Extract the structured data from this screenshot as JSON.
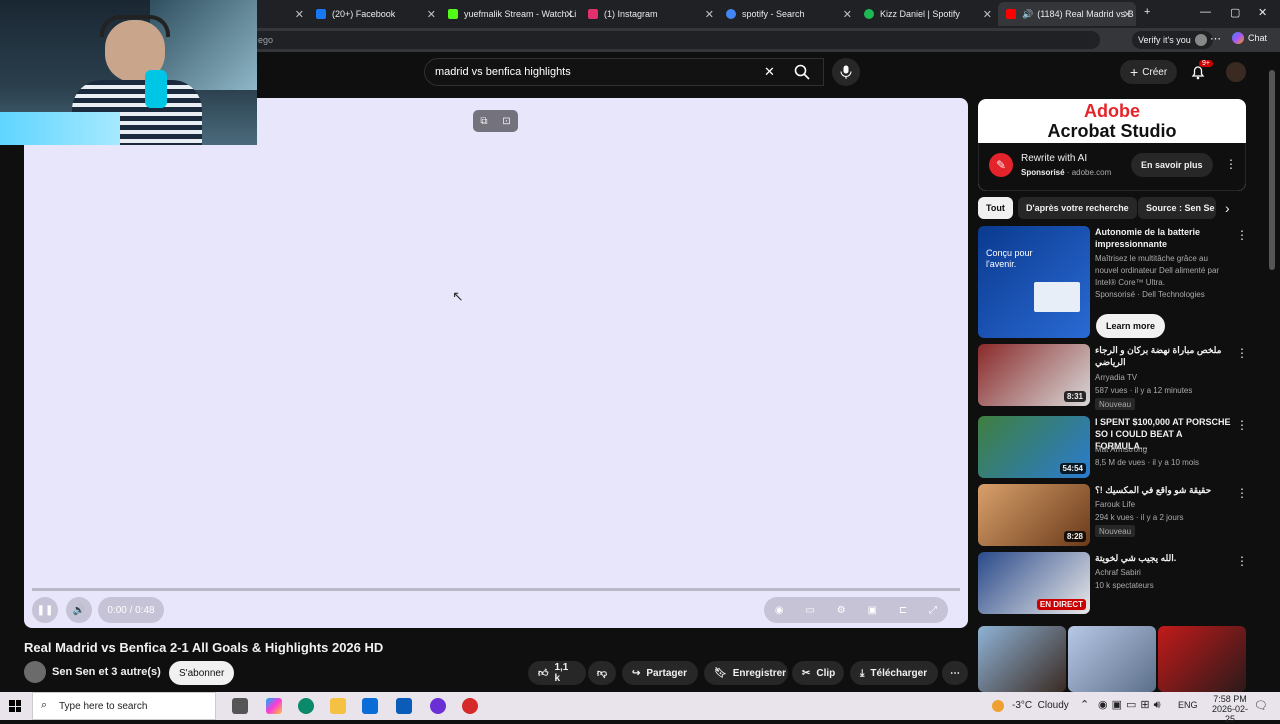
{
  "browser": {
    "tabs": [
      {
        "label": "(20+) Facebook",
        "color": "#1877f2"
      },
      {
        "label": "yuefmalik Stream - Watch Li",
        "color": "#53fc18"
      },
      {
        "label": "(1) Instagram",
        "color": "#e1306c"
      },
      {
        "label": "spotify - Search",
        "color": "#4285f4"
      },
      {
        "label": "Kizz Daniel | Spotify",
        "color": "#1db954"
      },
      {
        "label": "(1184) Real Madrid vs B",
        "color": "#ff0000"
      }
    ],
    "address_partial": "ego",
    "verify_label": "Verify it's you",
    "chat_label": "Chat"
  },
  "youtube": {
    "search_value": "madrid vs benfica highlights",
    "create_label": "Créer",
    "notif_count": "9+"
  },
  "player": {
    "time": "0:00 / 0:48",
    "progress": 0
  },
  "video": {
    "title": "Real Madrid vs Benfica 2-1 All Goals & Highlights 2026 HD",
    "channel": "Sen Sen et 3 autre(s)",
    "subscribe_label": "S'abonner",
    "likes": "1,1 k",
    "share_label": "Partager",
    "save_label": "Enregistrer",
    "clip_label": "Clip",
    "download_label": "Télécharger"
  },
  "ad": {
    "brand_line1": "Adobe",
    "brand_line2": "Acrobat Studio",
    "headline": "Rewrite with AI",
    "sponsored": "Sponsorisé",
    "domain": "adobe.com",
    "cta": "En savoir plus"
  },
  "chips": [
    "Tout",
    "D'après votre recherche",
    "Source : Sen Se"
  ],
  "recommendations": [
    {
      "title": "Autonomie de la batterie impressionnante",
      "desc": "Maîtrisez le multitâche grâce au nouvel ordinateur Dell alimenté par Intel® Core™ Ultra.",
      "meta": "Sponsorisé · Dell Technologies",
      "cta": "Learn more",
      "thumb_text": "Conçu pour l'avenir."
    },
    {
      "title": "ملخص مباراة نهضة بركان و الرجاء الرياضي",
      "channel": "Arryadia TV",
      "meta": "587 vues · il y a 12 minutes",
      "badge": "Nouveau",
      "duration": "8:31"
    },
    {
      "title": "I SPENT $100,000 AT PORSCHE SO I COULD BEAT A FORMULA...",
      "channel": "Mat Armstrong",
      "meta": "8,5 M de vues · il y a 10 mois",
      "duration": "54:54"
    },
    {
      "title": "حقيقة شو واقع في المكسيك !؟",
      "channel": "Farouk Life",
      "meta": "294 k vues · il y a 2 jours",
      "badge": "Nouveau",
      "duration": "8:28"
    },
    {
      "title": "الله يجيب شي لخويتة.",
      "channel": "Achraf Sabiri",
      "meta": "10 k spectateurs",
      "duration": "EN DIRECT"
    }
  ],
  "taskbar": {
    "search_placeholder": "Type here to search",
    "weather": "-3°C  Cloudy",
    "lang": "ENG",
    "time": "7:58 PM",
    "date": "2026-02-25"
  }
}
